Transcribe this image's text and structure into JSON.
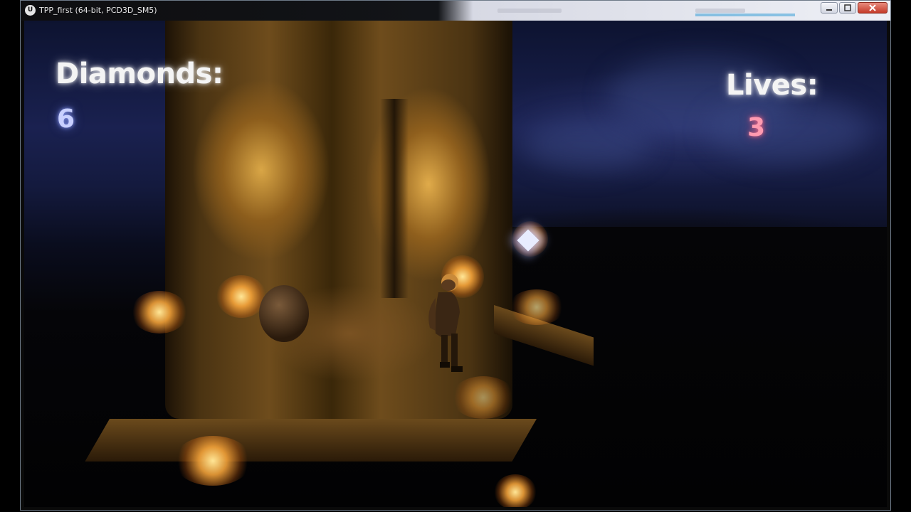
{
  "window": {
    "title": "TPP_first (64-bit, PCD3D_SM5)",
    "app_icon": "unreal-engine-icon",
    "controls": [
      "minimize-icon",
      "maximize-icon",
      "close-icon"
    ]
  },
  "hud": {
    "diamonds_label": "Diamonds:",
    "diamonds_value": "6",
    "lives_label": "Lives:",
    "lives_value": "3"
  },
  "colors": {
    "diamonds_value": "#c9d0ff",
    "lives_value": "#ff9ab0",
    "torch_glow": "#ffb040",
    "sky": "#1a2150"
  }
}
